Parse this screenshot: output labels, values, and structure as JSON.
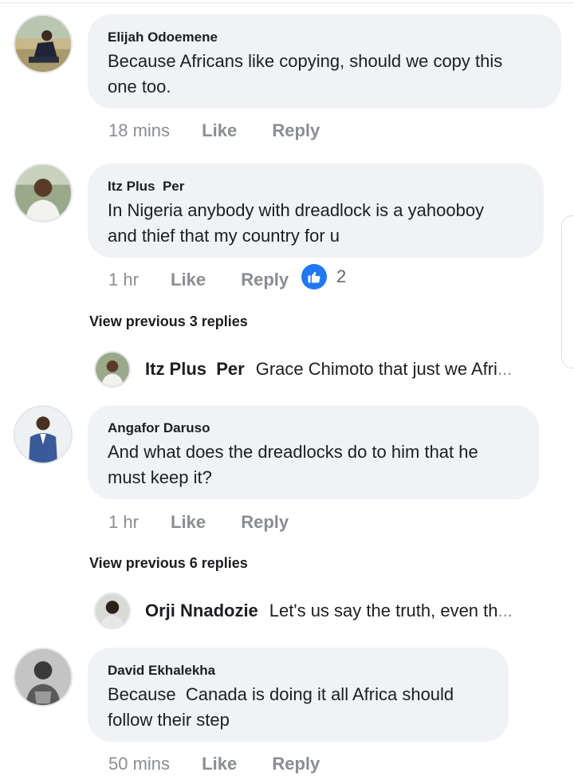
{
  "comments": [
    {
      "author": "Elijah Odoemene",
      "text_lines": [
        "Because Africans like copying, should we copy this",
        "one too."
      ],
      "time": "18 mins",
      "like": "Like",
      "reply": "Reply"
    },
    {
      "author": "Itz Plus  Per",
      "text_lines": [
        "In Nigeria anybody with dreadlock is a yahooboy",
        "and thief that my country for u"
      ],
      "time": "1 hr",
      "like": "Like",
      "reply": "Reply",
      "reaction_count": "2",
      "reaction_icon": "thumbs-up-icon",
      "reaction_color": "#2078f4"
    },
    {
      "author": "Angafor Daruso",
      "text_lines": [
        "And what does the dreadlocks do to him that he",
        "must keep it?"
      ],
      "time": "1 hr",
      "like": "Like",
      "reply": "Reply"
    },
    {
      "author": "David Ekhalekha",
      "text_lines": [
        "Because  Canada is doing it all Africa should",
        "follow their step"
      ],
      "time": "50 mins",
      "like": "Like",
      "reply": "Reply"
    }
  ],
  "threads": [
    {
      "view_previous": "View previous 3 replies",
      "reply_author": "Itz Plus  Per",
      "reply_text": "Grace Chimoto that just we Afri",
      "ellipsis": "..."
    },
    {
      "view_previous": "View previous 6 replies",
      "reply_author": "Orji Nnadozie",
      "reply_text": "Let's us say the truth, even th",
      "ellipsis": "..."
    }
  ],
  "colors": {
    "bubble": "#f0f2f5",
    "meta": "#8a8d91",
    "accent": "#2078f4"
  }
}
